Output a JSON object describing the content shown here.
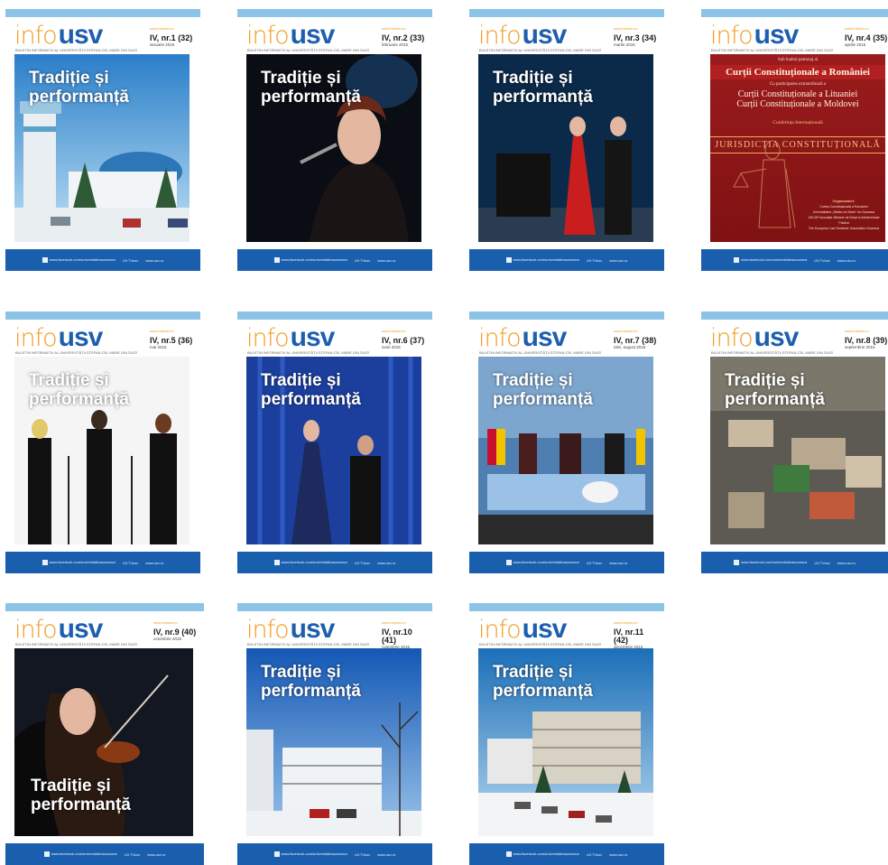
{
  "brand": {
    "logo_info": "info",
    "logo_usv": "usv",
    "tagline": "BULETIN INFORMATIV AL UNIVERSITĂȚII ȘTEFAN CEL MARE DIN SUCEAVA",
    "site": "www.infousv.ro",
    "footer_facebook": "www.facebook.com/universitateasuceava",
    "footer_tv": "UV.TVusv",
    "footer_web": "www.usv.ro"
  },
  "covers": [
    {
      "issue": "IV, nr.1 (32)",
      "month": "ianuarie 2015",
      "title": "Tradiție și performanță",
      "scene": "winter-building"
    },
    {
      "issue": "IV, nr.2 (33)",
      "month": "februarie 2015",
      "title": "Tradiție și performanță",
      "scene": "singer"
    },
    {
      "issue": "IV, nr.3 (34)",
      "month": "martie 2015",
      "title": "Tradiție și performanță",
      "scene": "duet"
    },
    {
      "issue": "IV, nr.4 (35)",
      "month": "aprilie 2015",
      "title": "",
      "scene": "red-constitutional"
    },
    {
      "issue": "IV, nr.5 (36)",
      "month": "mai 2015",
      "title": "Tradiție și performanță",
      "scene": "violins"
    },
    {
      "issue": "IV, nr.6 (37)",
      "month": "iunie 2015",
      "title": "Tradiție și performanță",
      "scene": "stage-blue"
    },
    {
      "issue": "IV, nr.7 (38)",
      "month": "iulie, august 2015",
      "title": "Tradiție și performanță",
      "scene": "ceremony"
    },
    {
      "issue": "IV, nr.8 (39)",
      "month": "septembrie 2015",
      "title": "Tradiție și performanță",
      "scene": "aerial"
    },
    {
      "issue": "IV, nr.9 (40)",
      "month": "octombrie 2015",
      "title": "Tradiție și performanță",
      "scene": "violinist"
    },
    {
      "issue": "IV, nr.10 (41)",
      "month": "noiembrie 2015",
      "title": "Tradiție și performanță",
      "scene": "snow-campus"
    },
    {
      "issue": "IV, nr.11 (42)",
      "month": "decembrie 2015",
      "title": "Tradiție și performanță",
      "scene": "snow-parking"
    }
  ],
  "red_cover": {
    "line1": "Sub înaltul patronaj al",
    "line2": "Curții Constituționale a României",
    "line3": "Cu participarea extraordinară a",
    "line4a": "Curții Constituționale a Lituaniei",
    "line4b": "Curții Constituționale a Moldovei",
    "line5": "Conferința Internațională",
    "line6": "JURISDICȚIA CONSTITUȚIONALĂ",
    "org_title": "Organizatori:",
    "org1": "Curtea Constituțională a României",
    "org2": "Universitatea „Ștefan cel Mare” din Suceava",
    "org3": "ASCAP Asociația Științele de Drept și Administrație Publică",
    "org4": "The European Law Students' Association Suceava"
  },
  "colors": {
    "accent_blue": "#1a5fad",
    "accent_orange": "#f39a1f",
    "top_bar": "#8cc4e6",
    "red_cover": "#9b1b1c"
  }
}
